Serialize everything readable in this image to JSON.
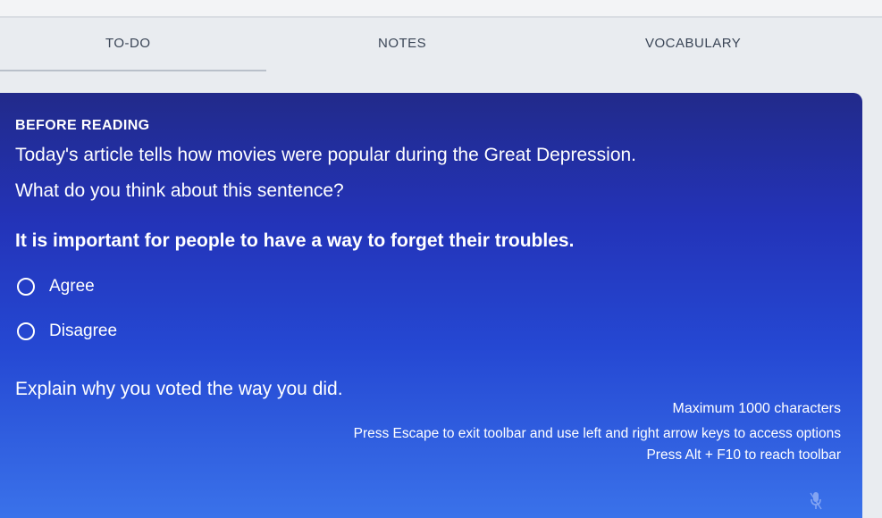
{
  "tabs": {
    "todo": "TO-DO",
    "notes": "NOTES",
    "vocabulary": "VOCABULARY"
  },
  "panel": {
    "section_title": "BEFORE READING",
    "intro_line1": "Today's article tells how movies were popular during the Great Depression.",
    "intro_line2": "What do you think about this sentence?",
    "statement": "It is important for people to have a way to forget their troubles.",
    "options": [
      "Agree",
      "Disagree"
    ],
    "explain_prompt": "Explain why you voted the way you did.",
    "max_chars": "Maximum 1000 characters",
    "hint_escape": "Press Escape to exit toolbar and use left and right arrow keys to access options",
    "hint_alt": "Press Alt + F10 to reach toolbar"
  },
  "icons": {
    "microphone": "microphone-icon"
  },
  "colors": {
    "panel_top": "#222a8a",
    "panel_bottom": "#3a72ea",
    "tab_text": "#3a4556"
  }
}
